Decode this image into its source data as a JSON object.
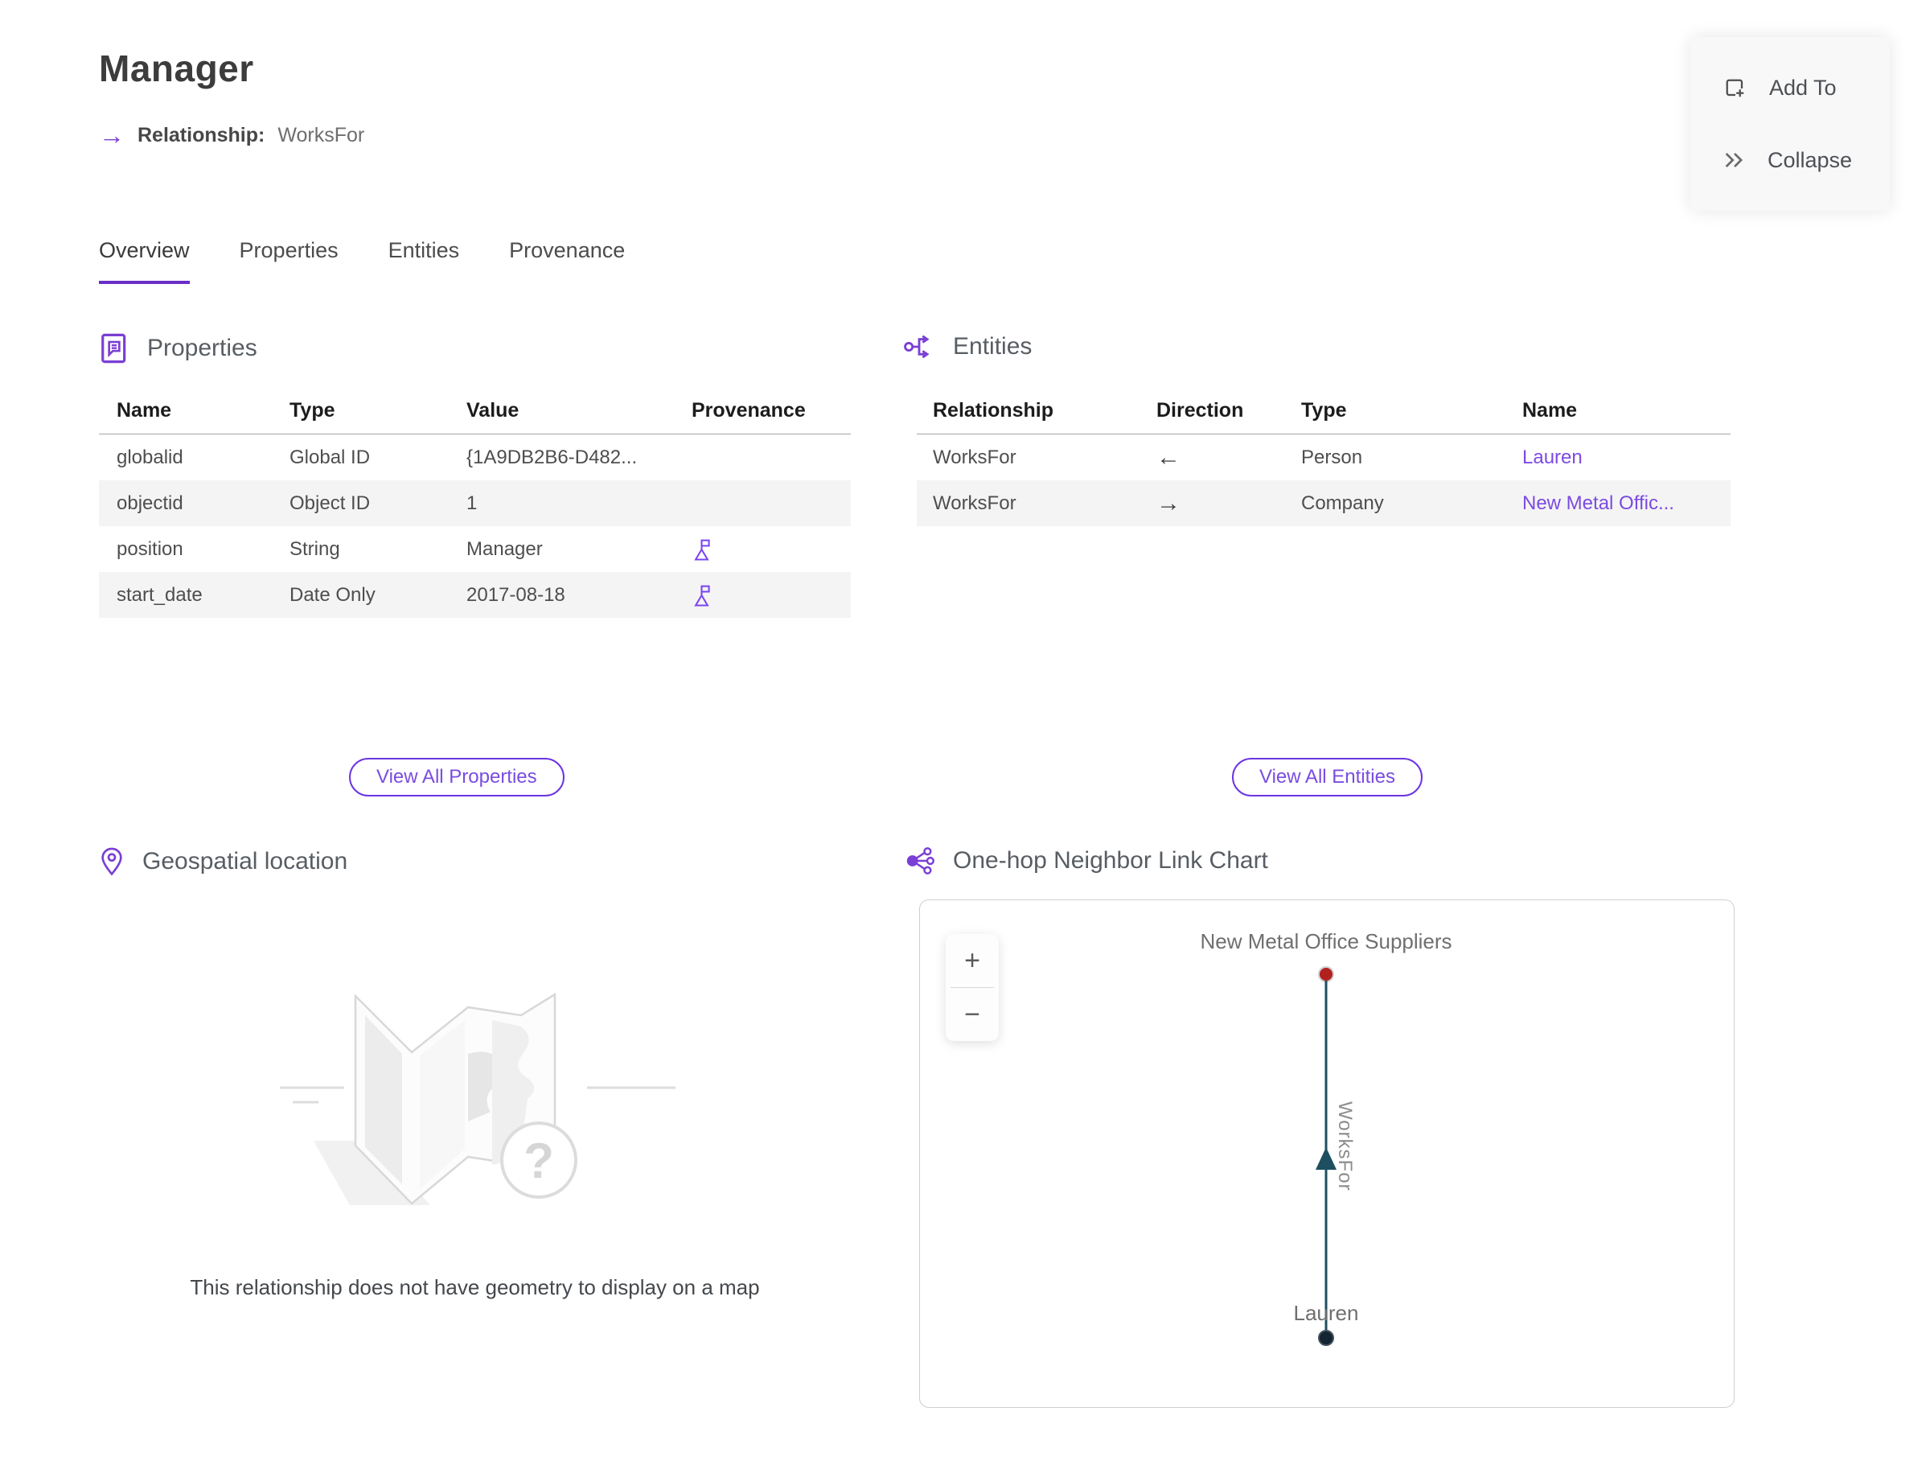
{
  "header": {
    "title": "Manager",
    "arrow_icon": "→",
    "subtitle_label": "Relationship:",
    "subtitle_value": "WorksFor"
  },
  "actions": {
    "add_to": "Add To",
    "collapse": "Collapse"
  },
  "tabs": [
    {
      "label": "Overview",
      "active": true
    },
    {
      "label": "Properties",
      "active": false
    },
    {
      "label": "Entities",
      "active": false
    },
    {
      "label": "Provenance",
      "active": false
    }
  ],
  "properties_section": {
    "title": "Properties",
    "columns": [
      "Name",
      "Type",
      "Value",
      "Provenance"
    ],
    "rows": [
      {
        "name": "globalid",
        "type": "Global ID",
        "value": "{1A9DB2B6-D482...",
        "has_provenance": false
      },
      {
        "name": "objectid",
        "type": "Object ID",
        "value": "1",
        "has_provenance": false
      },
      {
        "name": "position",
        "type": "String",
        "value": "Manager",
        "has_provenance": true
      },
      {
        "name": "start_date",
        "type": "Date Only",
        "value": "2017-08-18",
        "has_provenance": true
      }
    ],
    "view_all_label": "View All Properties"
  },
  "entities_section": {
    "title": "Entities",
    "columns": [
      "Relationship",
      "Direction",
      "Type",
      "Name"
    ],
    "rows": [
      {
        "relationship": "WorksFor",
        "direction": "←",
        "type": "Person",
        "name": "Lauren"
      },
      {
        "relationship": "WorksFor",
        "direction": "→",
        "type": "Company",
        "name": "New Metal Offic..."
      }
    ],
    "view_all_label": "View All Entities"
  },
  "geospatial_section": {
    "title": "Geospatial location",
    "empty_message": "This relationship does not have geometry to display on a map",
    "placeholder_glyph": "?"
  },
  "link_chart_section": {
    "title": "One-hop Neighbor Link Chart",
    "zoom_in_label": "+",
    "zoom_out_label": "−",
    "top_node": {
      "label": "New Metal Office Suppliers",
      "color": "#b32020"
    },
    "bottom_node": {
      "label": "Lauren",
      "color": "#132433"
    },
    "edge": {
      "label": "WorksFor",
      "color": "#1d4f60"
    }
  },
  "colors": {
    "accent_purple": "#6a2dc7",
    "link_purple": "#7c4ae2",
    "icon_purple": "#7a3fd4",
    "edge_teal": "#1d4f60",
    "node_red": "#b32020",
    "node_navy": "#132433",
    "row_alt_bg": "#f4f4f4"
  }
}
